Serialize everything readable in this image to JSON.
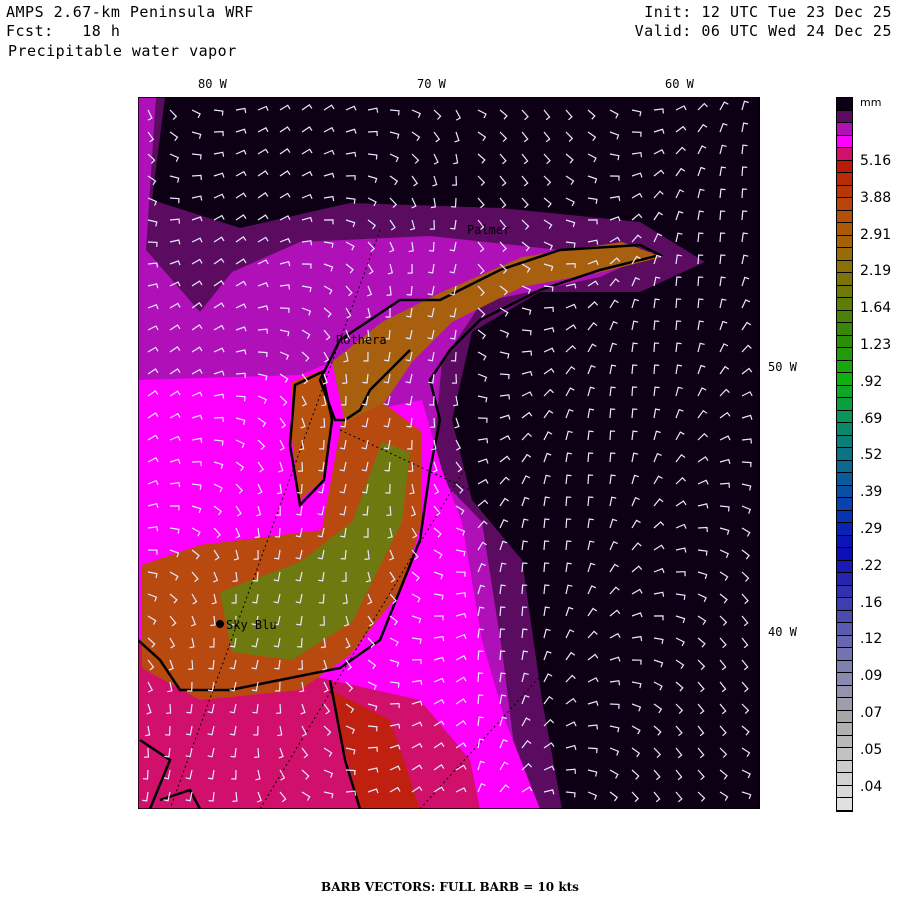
{
  "header": {
    "model": "AMPS 2.67-km Peninsula WRF",
    "forecast": "Fcst:   18 h",
    "field": "Precipitable water vapor",
    "init": "Init: 12 UTC Tue 23 Dec 25",
    "valid": "Valid: 06 UTC Wed 24 Dec 25"
  },
  "map": {
    "lon_labels_top": [
      "80 W",
      "70 W",
      "60 W"
    ],
    "lon_labels_right": [
      "50 W",
      "40 W"
    ],
    "stations": [
      "Palmer",
      "Rothera",
      "Sky Blu"
    ]
  },
  "colorbar": {
    "unit": "mm",
    "labels": [
      "5.16",
      "3.88",
      "2.91",
      "2.19",
      "1.64",
      "1.23",
      ".92",
      ".69",
      ".52",
      ".39",
      ".29",
      ".22",
      ".16",
      ".12",
      ".09",
      ".07",
      ".05",
      ".04"
    ],
    "top_colors": [
      "#0e0014",
      "#5c0c60",
      "#b010b8",
      "#ff00ff",
      "#d0106a"
    ],
    "gradient_anchors": [
      "#b81c08",
      "#b84a08",
      "#9c6a08",
      "#6a7a08",
      "#2e8a08",
      "#10b010",
      "#0a9060",
      "#0a6a90",
      "#0a40b0",
      "#0a0ab8",
      "#3030b0",
      "#6060b0",
      "#8888b0",
      "#a8a8a8",
      "#c8c8c8",
      "#e0e0e0"
    ]
  },
  "footer": "BARB VECTORS:  FULL BARB = 10 kts"
}
